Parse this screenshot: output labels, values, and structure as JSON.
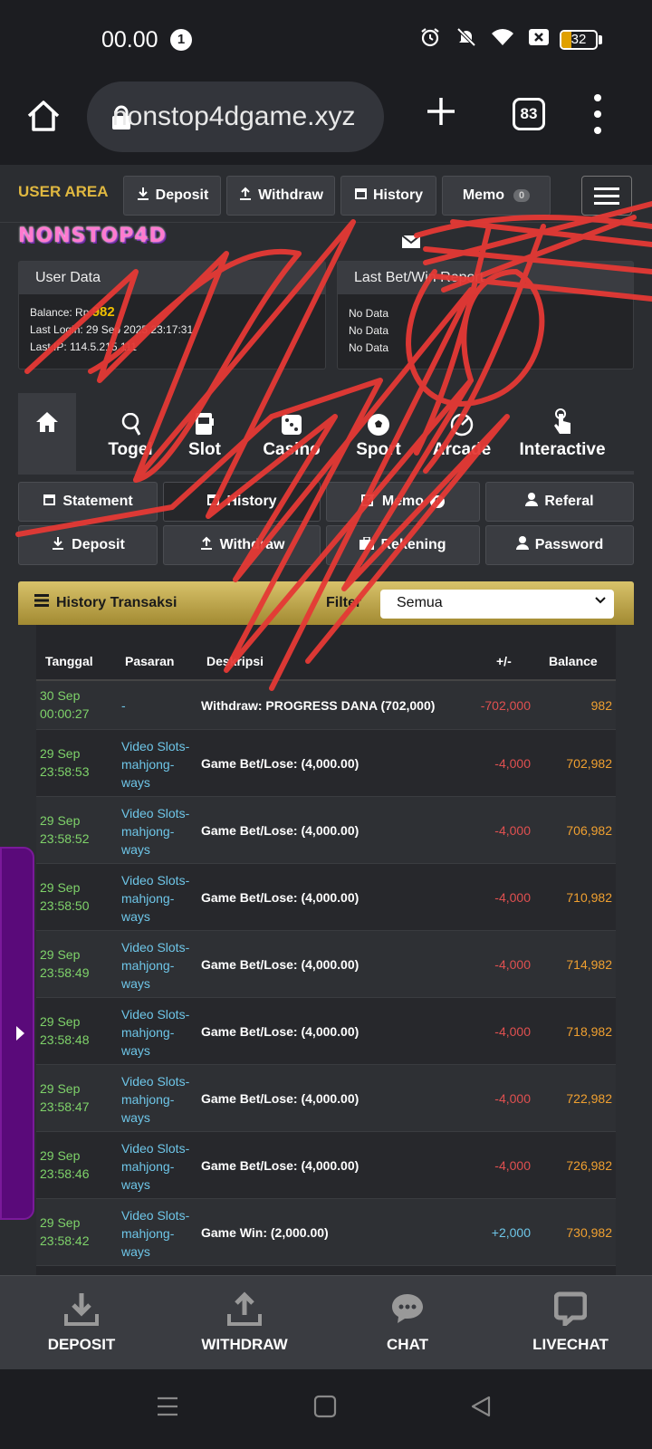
{
  "status_bar": {
    "time": "00.00",
    "notification_count": "1",
    "battery": "32"
  },
  "browser": {
    "url": "nonstop4dgame.xyz",
    "tab_count": "83"
  },
  "topnav": {
    "user_area": "USER AREA",
    "deposit": "Deposit",
    "withdraw": "Withdraw",
    "history": "History",
    "memo": "Memo",
    "memo_count": "0"
  },
  "logo": "NONSTOP4D",
  "user_data": {
    "title": "User Data",
    "balance_label": "Balance: Rp",
    "balance_value": "982",
    "last_login": "Last Login: 29 Sep 2025 23:17:31",
    "last_ip": "Last IP: 114.5.215.111"
  },
  "last_bet": {
    "title": "Last Bet/Win Report",
    "lines": [
      "No Data",
      "No Data",
      "No Data"
    ]
  },
  "categories": {
    "home": "",
    "togel": "Togel",
    "slot": "Slot",
    "casino": "Casino",
    "sport": "Sport",
    "arcade": "Arcade",
    "interactive": "Interactive"
  },
  "subnav": {
    "statement": "Statement",
    "history": "History",
    "memo": "Memo",
    "memo_count": "0",
    "referal": "Referal",
    "deposit": "Deposit",
    "withdraw": "Withdraw",
    "rekening": "Rekening",
    "password": "Password"
  },
  "history": {
    "title": "History Transaksi",
    "filter_label": "Filter",
    "filter_value": "Semua",
    "columns": [
      "Tanggal",
      "Pasaran",
      "Deskripsi",
      "+/-",
      "Balance"
    ],
    "rows": [
      {
        "date1": "30 Sep",
        "date2": "00:00:27",
        "pasaran": "-",
        "desc": "Withdraw: PROGRESS DANA (702,000)",
        "amount": "-702,000",
        "balance": "982"
      },
      {
        "date1": "29 Sep",
        "date2": "23:58:53",
        "pasaran": "Video Slots-mahjong-ways",
        "desc": "Game Bet/Lose: (4,000.00)",
        "amount": "-4,000",
        "balance": "702,982"
      },
      {
        "date1": "29 Sep",
        "date2": "23:58:52",
        "pasaran": "Video Slots-mahjong-ways",
        "desc": "Game Bet/Lose: (4,000.00)",
        "amount": "-4,000",
        "balance": "706,982"
      },
      {
        "date1": "29 Sep",
        "date2": "23:58:50",
        "pasaran": "Video Slots-mahjong-ways",
        "desc": "Game Bet/Lose: (4,000.00)",
        "amount": "-4,000",
        "balance": "710,982"
      },
      {
        "date1": "29 Sep",
        "date2": "23:58:49",
        "pasaran": "Video Slots-mahjong-ways",
        "desc": "Game Bet/Lose: (4,000.00)",
        "amount": "-4,000",
        "balance": "714,982"
      },
      {
        "date1": "29 Sep",
        "date2": "23:58:48",
        "pasaran": "Video Slots-mahjong-ways",
        "desc": "Game Bet/Lose: (4,000.00)",
        "amount": "-4,000",
        "balance": "718,982"
      },
      {
        "date1": "29 Sep",
        "date2": "23:58:47",
        "pasaran": "Video Slots-mahjong-ways",
        "desc": "Game Bet/Lose: (4,000.00)",
        "amount": "-4,000",
        "balance": "722,982"
      },
      {
        "date1": "29 Sep",
        "date2": "23:58:46",
        "pasaran": "Video Slots-mahjong-ways",
        "desc": "Game Bet/Lose: (4,000.00)",
        "amount": "-4,000",
        "balance": "726,982"
      },
      {
        "date1": "29 Sep",
        "date2": "23:58:42",
        "pasaran": "Video Slots-mahjong-ways",
        "desc": "Game Win: (2,000.00)",
        "amount": "+2,000",
        "balance": "730,982"
      }
    ]
  },
  "bottom_nav": {
    "deposit": "DEPOSIT",
    "withdraw": "WITHDRAW",
    "chat": "CHAT",
    "livechat": "LIVECHAT"
  },
  "colors": {
    "accent_gold": "#e0b840",
    "scribble_red": "#e53935",
    "side_tab": "#5a0a7a"
  }
}
